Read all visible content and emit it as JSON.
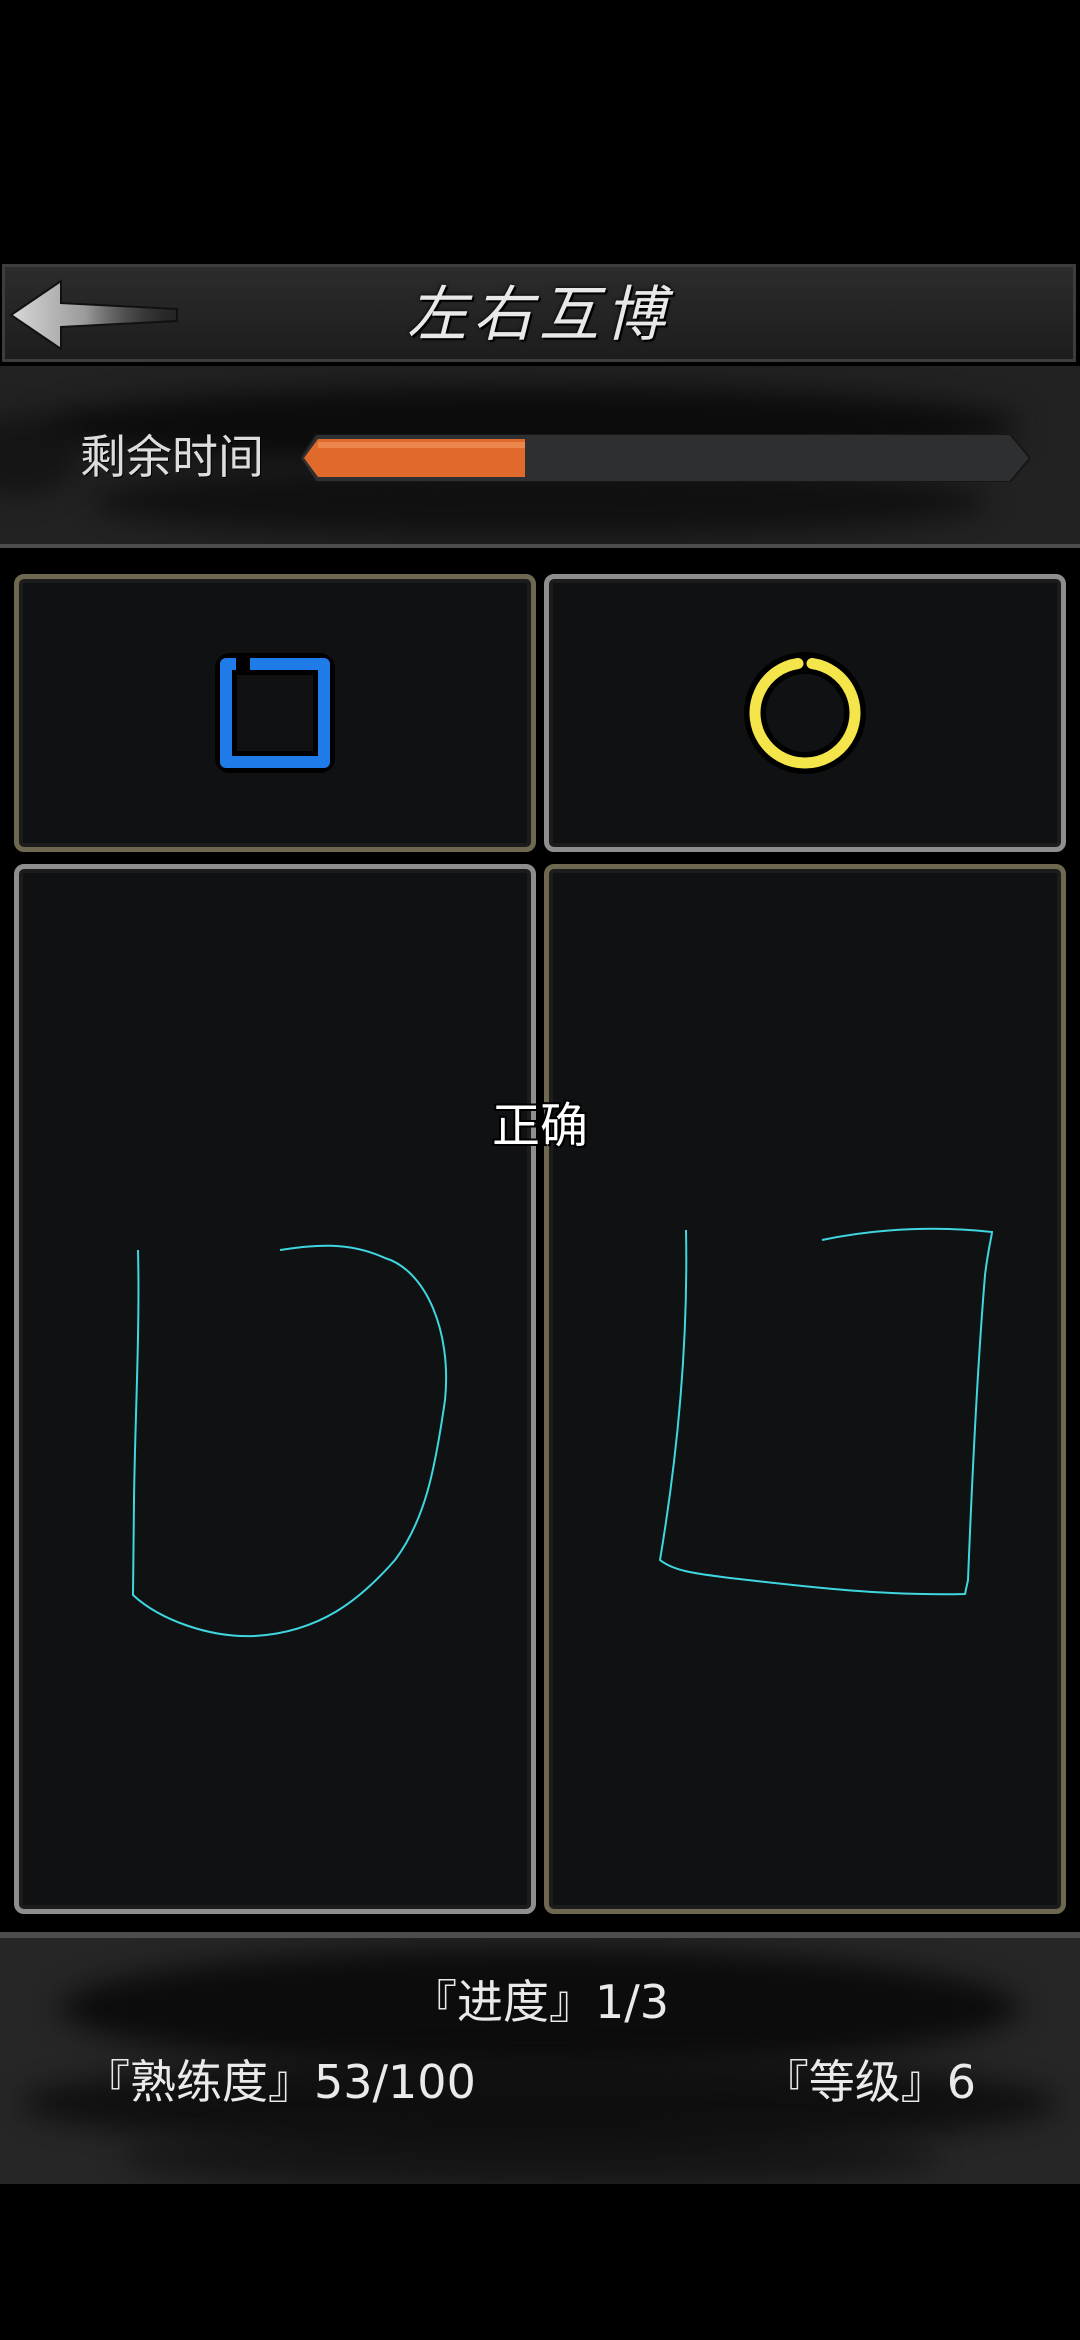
{
  "header": {
    "title": "左右互博",
    "back_icon": "back-arrow-icon"
  },
  "timer": {
    "label": "剩余时间",
    "remaining_fraction": 0.3,
    "fill_color": "#e06a2c"
  },
  "targets": {
    "left_shape": "square-icon",
    "left_color": "#1e7be8",
    "right_shape": "circle-icon",
    "right_color": "#f4e64a"
  },
  "drawing": {
    "stroke_color": "#3fd6e0"
  },
  "result": {
    "text": "正确"
  },
  "stats": {
    "progress_label": "『进度』",
    "progress_value": "1/3",
    "mastery_label": "『熟练度』",
    "mastery_value": "53/100",
    "level_label": "『等级』",
    "level_value": "6"
  }
}
